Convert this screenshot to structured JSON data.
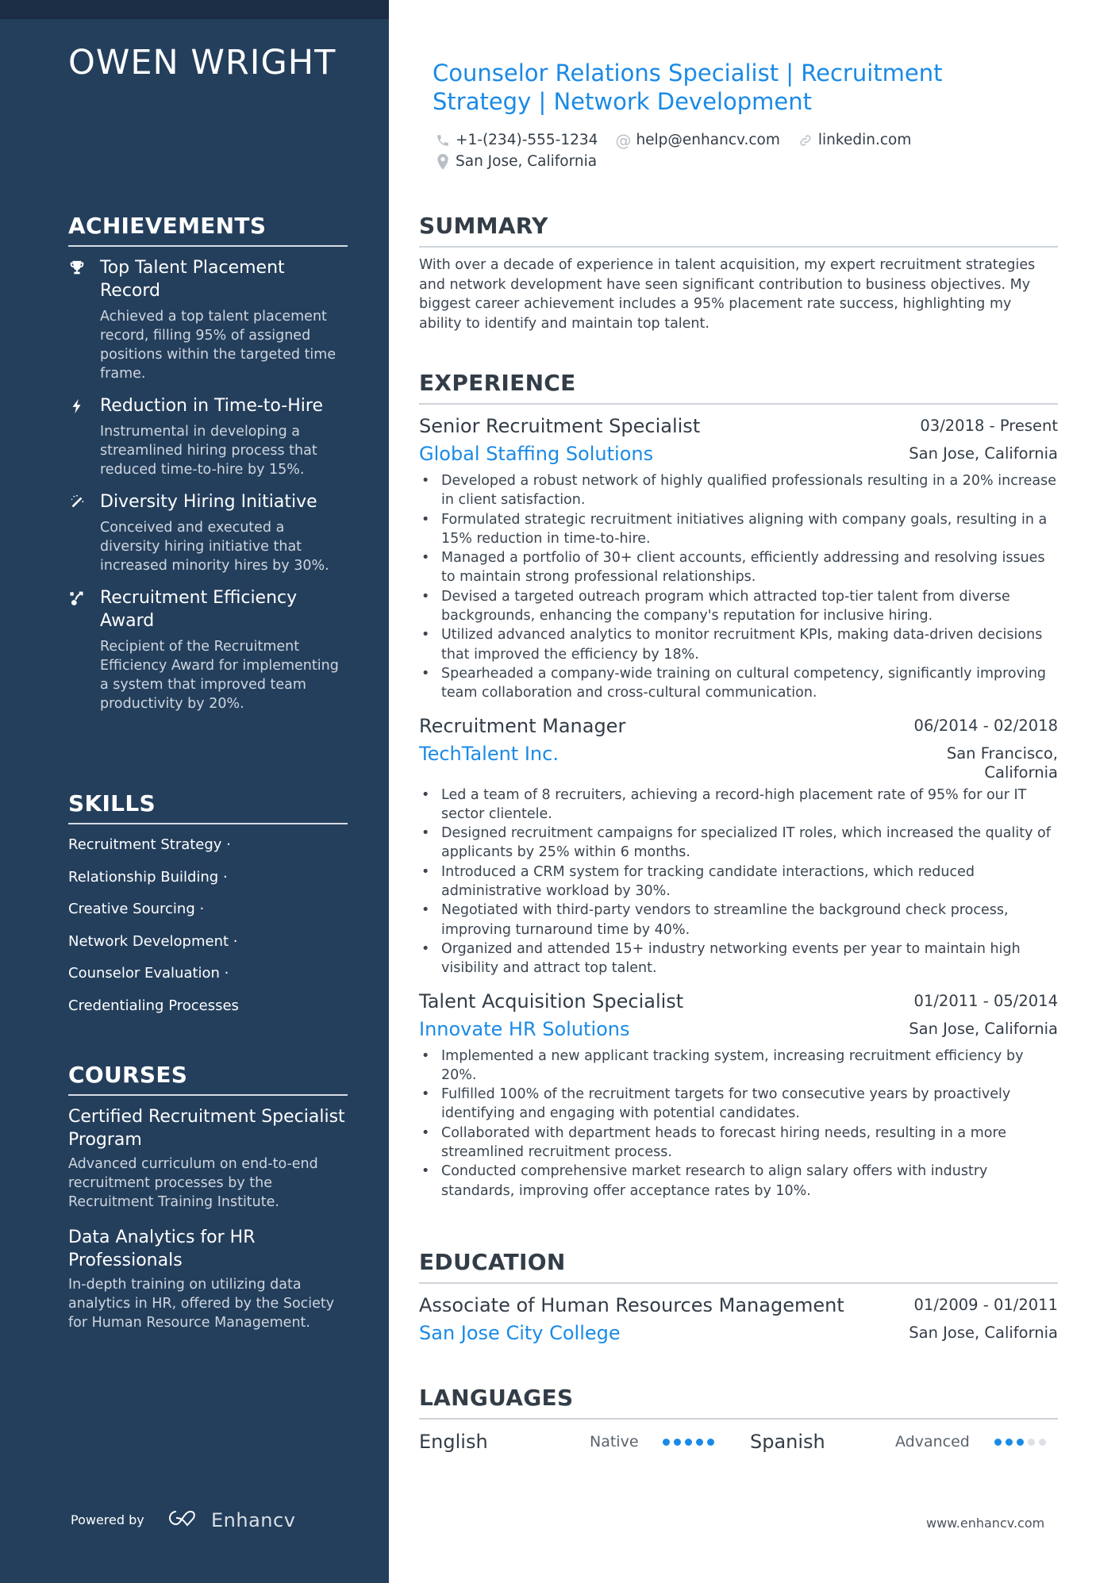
{
  "profile": {
    "name": "OWEN WRIGHT",
    "headline": "Counselor Relations Specialist | Recruitment Strategy | Network Development",
    "phone": "+1-(234)-555-1234",
    "email": "help@enhancv.com",
    "link": "linkedin.com",
    "location": "San Jose, California"
  },
  "sidebar": {
    "achievements": {
      "heading": "ACHIEVEMENTS",
      "items": [
        {
          "icon": "trophy-icon",
          "title": "Top Talent Placement Record",
          "desc": "Achieved a top talent placement record, filling 95% of assigned positions within the targeted time frame."
        },
        {
          "icon": "lightning-icon",
          "title": "Reduction in Time-to-Hire",
          "desc": "Instrumental in developing a streamlined hiring process that reduced time-to-hire by 15%."
        },
        {
          "icon": "magic-wand-icon",
          "title": "Diversity Hiring Initiative",
          "desc": "Conceived and executed a diversity hiring initiative that increased minority hires by 30%."
        },
        {
          "icon": "strategy-icon",
          "title": "Recruitment Efficiency Award",
          "desc": "Recipient of the Recruitment Efficiency Award for implementing a system that improved team productivity by 20%."
        }
      ]
    },
    "skills": {
      "heading": "SKILLS",
      "items": [
        "Recruitment Strategy ·",
        "Relationship Building ·",
        "Creative Sourcing ·",
        "Network Development ·",
        "Counselor Evaluation ·",
        "Credentialing Processes"
      ]
    },
    "courses": {
      "heading": "COURSES",
      "items": [
        {
          "title": "Certified Recruitment Specialist Program",
          "desc": "Advanced curriculum on end-to-end recruitment processes by the Recruitment Training Institute."
        },
        {
          "title": "Data Analytics for HR Professionals",
          "desc": "In-depth training on utilizing data analytics in HR, offered by the Society for Human Resource Management."
        }
      ]
    },
    "powered_by": "Powered by",
    "brand": "Enhancv"
  },
  "summary": {
    "heading": "SUMMARY",
    "text": "With over a decade of experience in talent acquisition, my expert recruitment strategies and network development have seen significant contribution to business objectives. My biggest career achievement includes a 95% placement rate success, highlighting my ability to identify and maintain top talent."
  },
  "experience": {
    "heading": "EXPERIENCE",
    "jobs": [
      {
        "title": "Senior Recruitment Specialist",
        "date": "03/2018 - Present",
        "company": "Global Staffing Solutions",
        "location": "San Jose, California",
        "bullets": [
          "Developed a robust network of highly qualified professionals resulting in a 20% increase in client satisfaction.",
          "Formulated strategic recruitment initiatives aligning with company goals, resulting in a 15% reduction in time-to-hire.",
          "Managed a portfolio of 30+ client accounts, efficiently addressing and resolving issues to maintain strong professional relationships.",
          "Devised a targeted outreach program which attracted top-tier talent from diverse backgrounds, enhancing the company's reputation for inclusive hiring.",
          "Utilized advanced analytics to monitor recruitment KPIs, making data-driven decisions that improved the efficiency by 18%.",
          "Spearheaded a company-wide training on cultural competency, significantly improving team collaboration and cross-cultural communication."
        ]
      },
      {
        "title": "Recruitment Manager",
        "date": "06/2014 - 02/2018",
        "company": "TechTalent Inc.",
        "location": "San Francisco, California",
        "bullets": [
          "Led a team of 8 recruiters, achieving a record-high placement rate of 95% for our IT sector clientele.",
          "Designed recruitment campaigns for specialized IT roles, which increased the quality of applicants by 25% within 6 months.",
          "Introduced a CRM system for tracking candidate interactions, which reduced administrative workload by 30%.",
          "Negotiated with third-party vendors to streamline the background check process, improving turnaround time by 40%.",
          "Organized and attended 15+ industry networking events per year to maintain high visibility and attract top talent."
        ]
      },
      {
        "title": "Talent Acquisition Specialist",
        "date": "01/2011 - 05/2014",
        "company": "Innovate HR Solutions",
        "location": "San Jose, California",
        "bullets": [
          "Implemented a new applicant tracking system, increasing recruitment efficiency by 20%.",
          "Fulfilled 100% of the recruitment targets for two consecutive years by proactively identifying and engaging with potential candidates.",
          "Collaborated with department heads to forecast hiring needs, resulting in a more streamlined recruitment process.",
          "Conducted comprehensive market research to align salary offers with industry standards, improving offer acceptance rates by 10%."
        ]
      }
    ]
  },
  "education": {
    "heading": "EDUCATION",
    "degree": "Associate of Human Resources Management",
    "date": "01/2009 - 01/2011",
    "school": "San Jose City College",
    "location": "San Jose, California"
  },
  "languages": {
    "heading": "LANGUAGES",
    "items": [
      {
        "name": "English",
        "level": "Native",
        "rating": 5,
        "max": 5
      },
      {
        "name": "Spanish",
        "level": "Advanced",
        "rating": 3,
        "max": 5
      }
    ]
  },
  "footer": {
    "site": "www.enhancv.com"
  },
  "colors": {
    "sidebar": "#243f5c",
    "topbar": "#1b2d44",
    "accent": "#1a8ae6",
    "text": "#333d47"
  }
}
